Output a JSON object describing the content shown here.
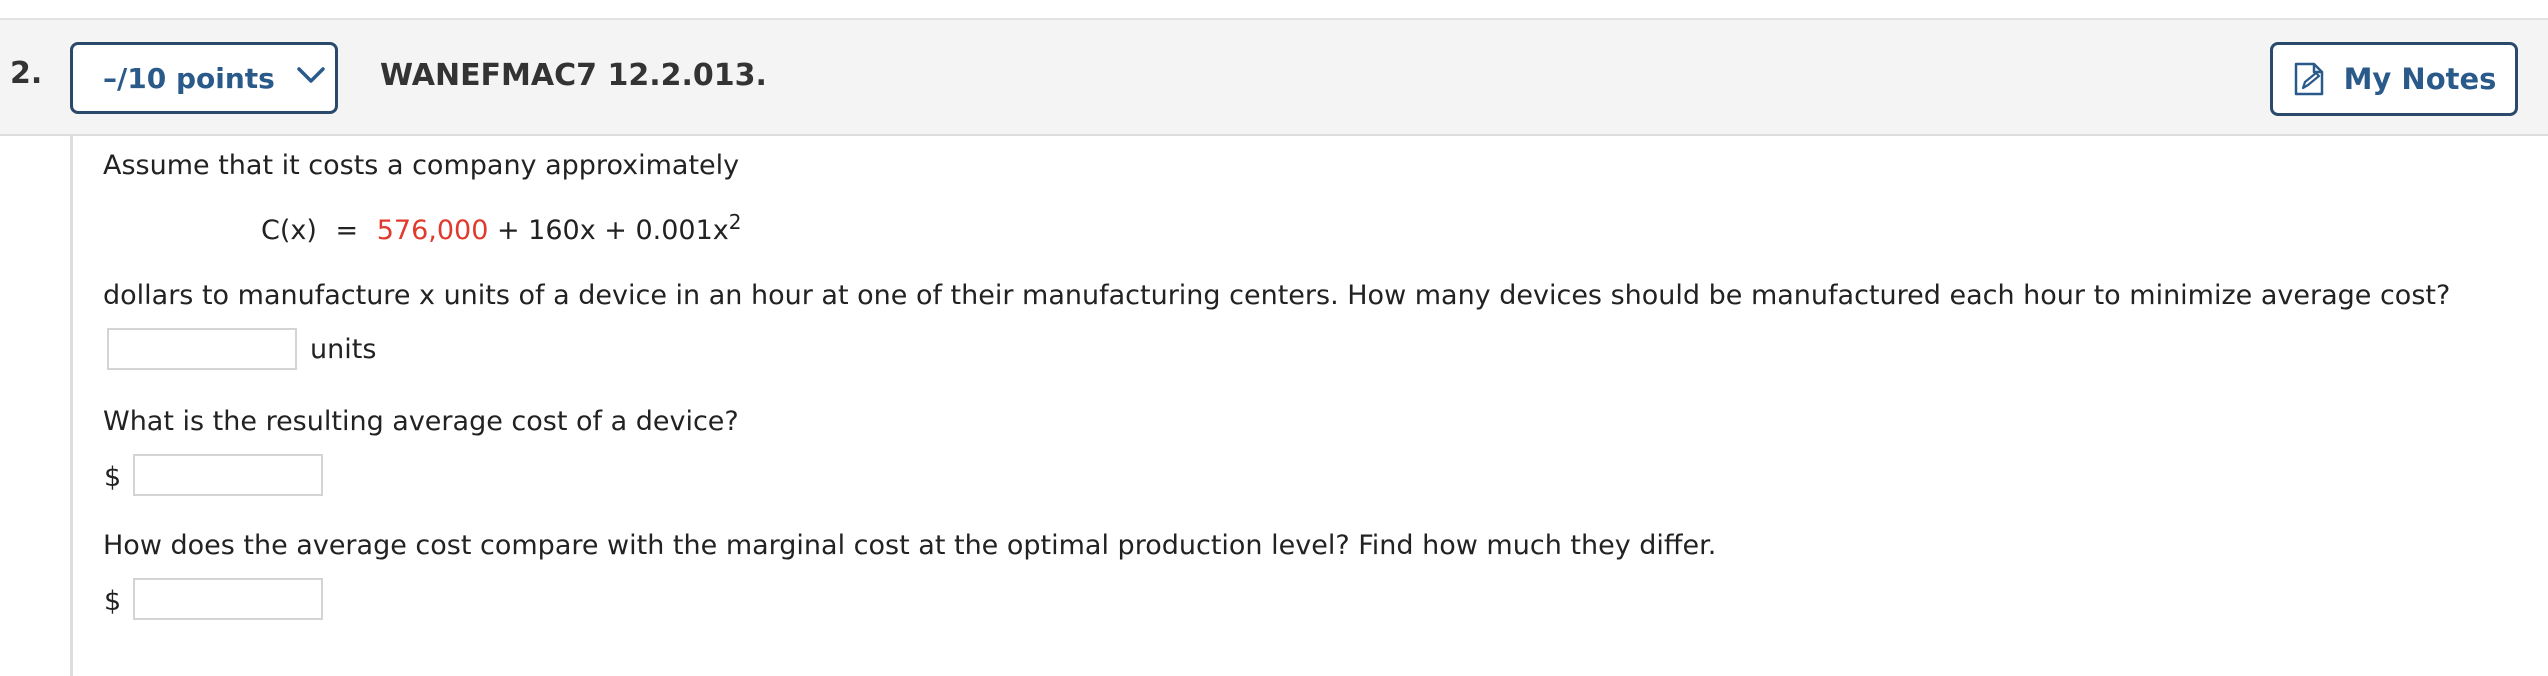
{
  "question": {
    "number": "2.",
    "points_label": "–/10 points",
    "code": "WANEFMAC7 12.2.013.",
    "notes_label": "My Notes"
  },
  "body": {
    "intro": "Assume that it costs a company approximately",
    "formula": {
      "lhs": "C(x)",
      "equals": "=",
      "constant": "576,000",
      "rest": " + 160x + 0.001x",
      "exponent": "2"
    },
    "statement": "dollars to manufacture x units of a device in an hour at one of their manufacturing centers. How many devices should be manufactured each hour to minimize average cost?",
    "answer1": {
      "value": "",
      "unit": "units"
    },
    "question2": "What is the resulting average cost of a device?",
    "answer2": {
      "prefix": "$",
      "value": ""
    },
    "question3": "How does the average cost compare with the marginal cost at the optimal production level? Find how much they differ.",
    "answer3": {
      "prefix": "$",
      "value": ""
    }
  },
  "colors": {
    "accent": "#2a5a8a",
    "border": "#2a4a6b",
    "highlight": "#e03a2f"
  }
}
